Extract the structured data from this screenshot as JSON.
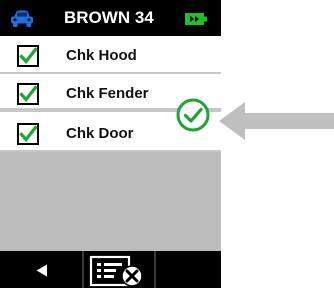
{
  "header": {
    "title": "BROWN 34",
    "left_icon": "car-icon",
    "right_icon": "battery-icon"
  },
  "checklist": {
    "items": [
      {
        "label": "Chk Hood",
        "checked": true
      },
      {
        "label": "Chk Fender",
        "checked": true
      },
      {
        "label": "Chk Door",
        "checked": true
      }
    ]
  },
  "status": {
    "icon": "checkmark-circle-icon"
  },
  "footer": {
    "back_icon": "back-arrow-icon",
    "cancel_icon": "cancel-list-icon"
  },
  "annotation": {
    "icon": "pointer-arrow-icon"
  },
  "colors": {
    "accent_blue": "#1f6fe0",
    "check_green": "#1ea534",
    "battery_green": "#22c024",
    "bar_black": "#000000",
    "screen_gray": "#bdbdbd",
    "arrow_gray": "#bfbfbf"
  }
}
